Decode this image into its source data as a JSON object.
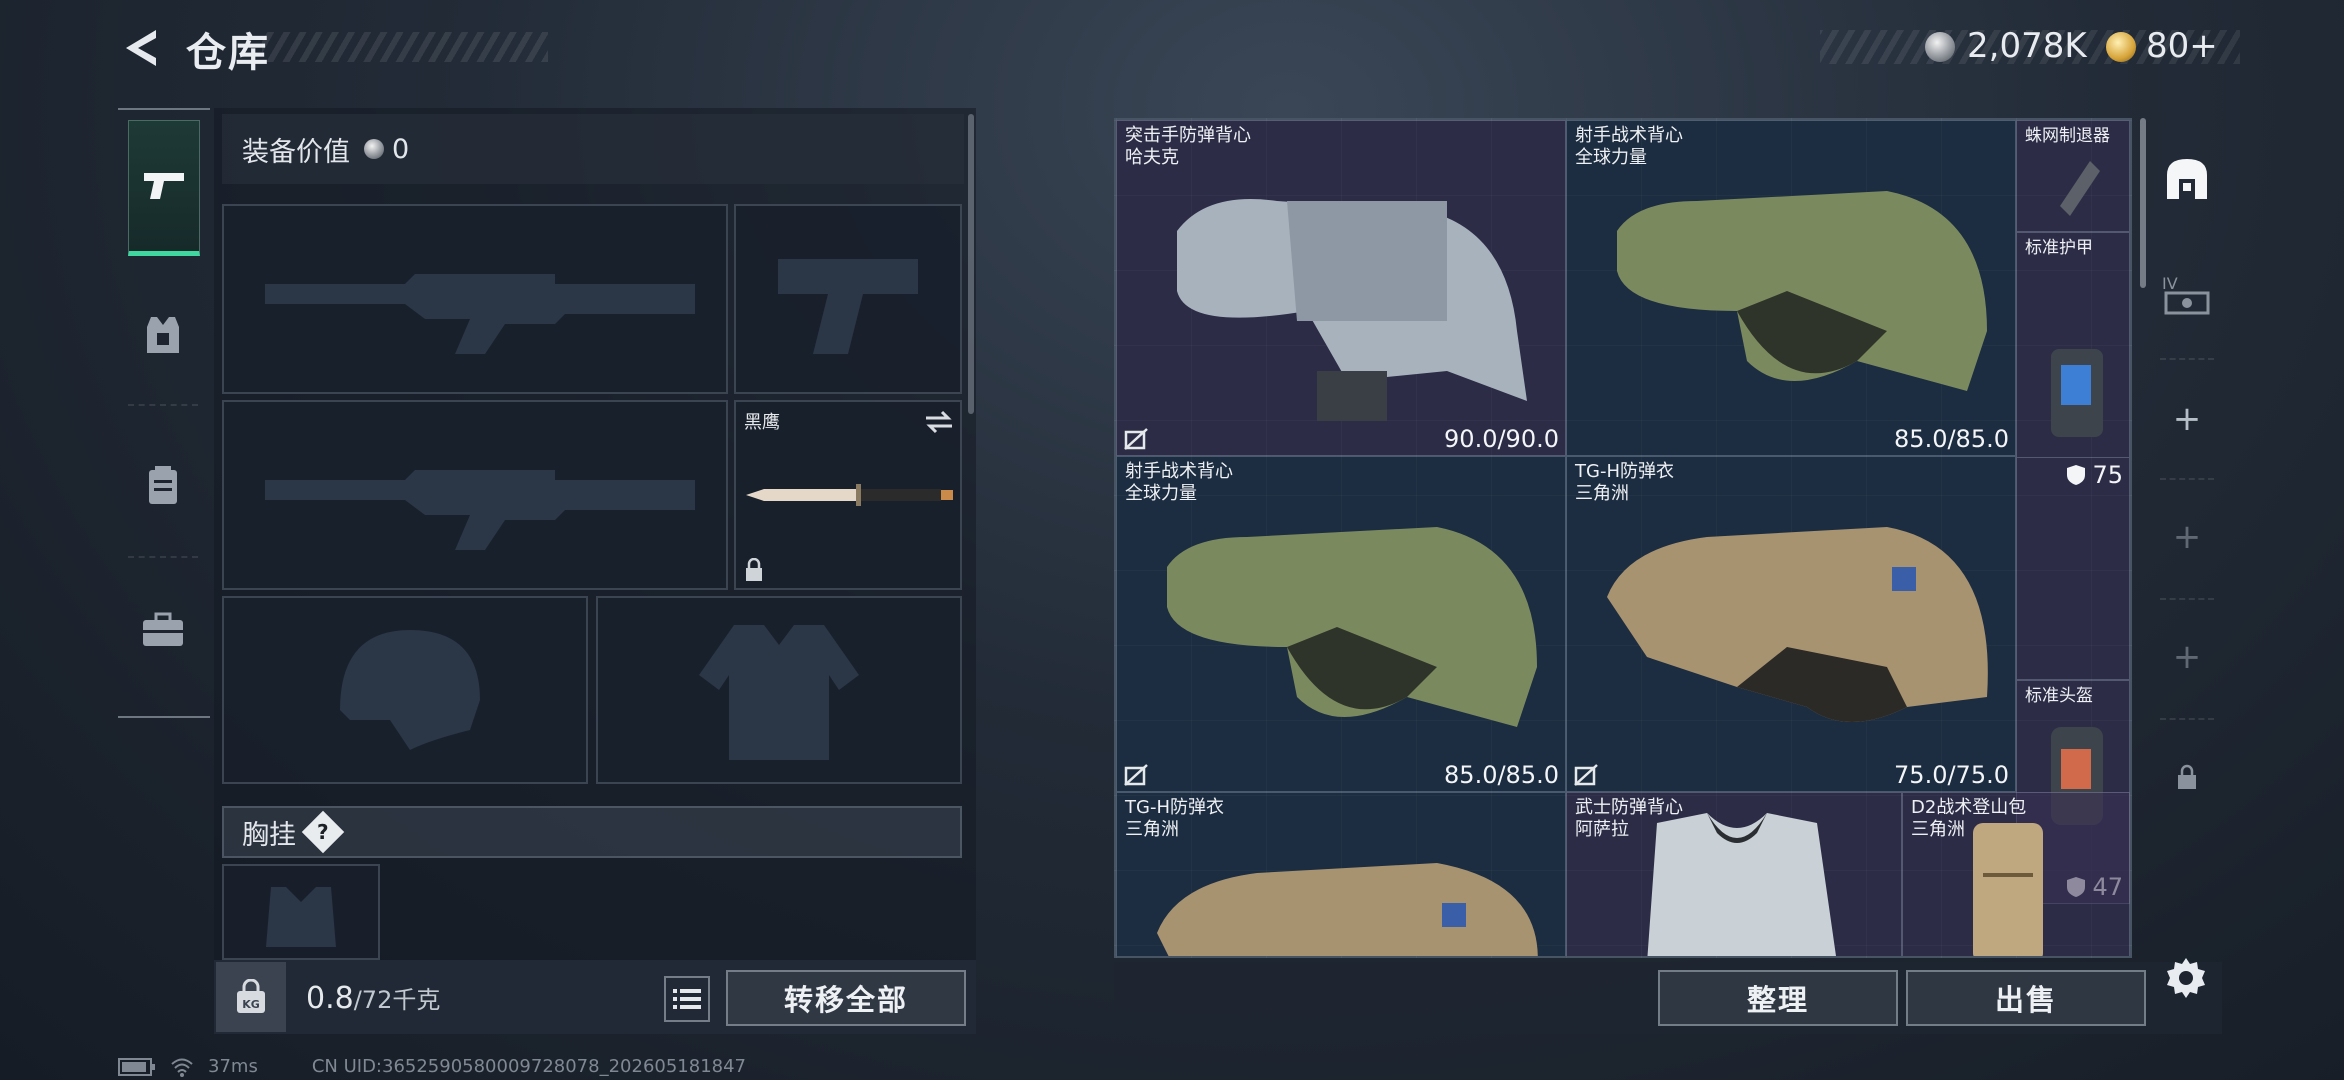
{
  "header": {
    "title": "仓库"
  },
  "currency": {
    "silver": "2,078K",
    "gold": "80+"
  },
  "equipment": {
    "value_label": "装备价值",
    "value": "0",
    "melee_name": "黑鹰",
    "chest_rig_label": "胸挂",
    "help": "?",
    "weight_current": "0.8",
    "weight_max": "/72千克",
    "transfer_all": "转移全部"
  },
  "inventory": {
    "items": [
      {
        "name": "突击手防弹背心",
        "brand": "哈夫克",
        "durability": "90.0/90.0",
        "rarity": "purple"
      },
      {
        "name": "射手战术背心",
        "brand": "全球力量",
        "durability": "85.0/85.0",
        "rarity": "blue"
      },
      {
        "name": "蛛网制退器",
        "brand": "",
        "durability": "",
        "rarity": "purple"
      },
      {
        "name": "标准护甲",
        "brand": "",
        "armor": "75",
        "rarity": "purple"
      },
      {
        "name": "射手战术背心",
        "brand": "全球力量",
        "durability": "85.0/85.0",
        "rarity": "blue"
      },
      {
        "name": "TG-H防弹衣",
        "brand": "三角洲",
        "durability": "75.0/75.0",
        "rarity": "blue"
      },
      {
        "name": "标准头盔",
        "brand": "",
        "armor": "47",
        "rarity": "purple"
      },
      {
        "name": "TG-H防弹衣",
        "brand": "三角洲",
        "durability": "",
        "rarity": "blue"
      },
      {
        "name": "武士防弹背心",
        "brand": "阿萨拉",
        "durability": "",
        "rarity": "purple"
      },
      {
        "name": "D2战术登山包",
        "brand": "三角洲",
        "durability": "",
        "rarity": "purple"
      }
    ],
    "sort": "整理",
    "sell": "出售"
  },
  "status": {
    "ping": "37ms",
    "uid": "CN UID:3652590580009728078_202605181847"
  },
  "colors": {
    "accent": "#3fd6a0",
    "purple": "#3a3054",
    "blue": "#1e3248"
  }
}
